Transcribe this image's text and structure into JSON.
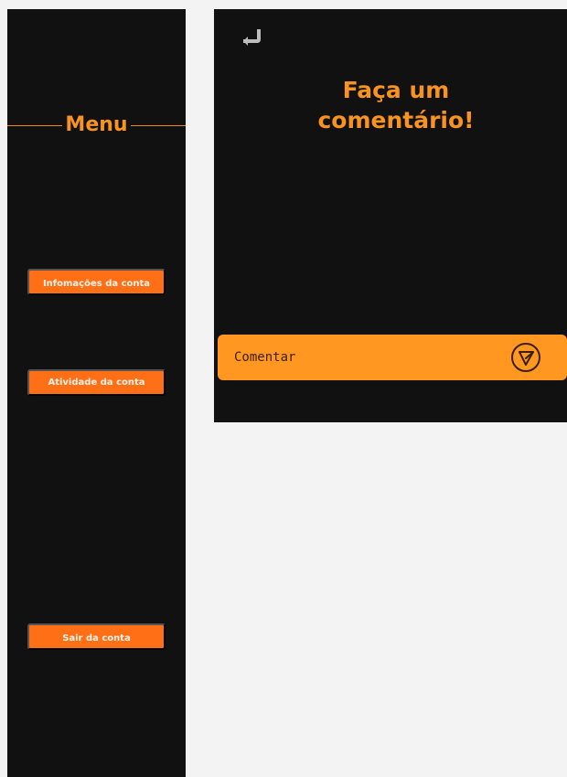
{
  "sidebar": {
    "title": "Menu",
    "buttons": {
      "account_info": "Infomações da conta",
      "account_activity": "Atividade da conta",
      "logout": "Sair da conta"
    }
  },
  "main": {
    "heading_line1": "Faça um",
    "heading_line2": "comentário!",
    "comment": {
      "placeholder": "Comentar",
      "value": ""
    }
  },
  "icons": {
    "back": "return-arrow-icon",
    "send": "send-icon"
  },
  "colors": {
    "dark_background": "#111111",
    "accent_orange": "#ff6f16",
    "comment_bar_orange": "#ff9721",
    "title_orange": "#f7931e",
    "page_background": "#f3f3f3"
  }
}
